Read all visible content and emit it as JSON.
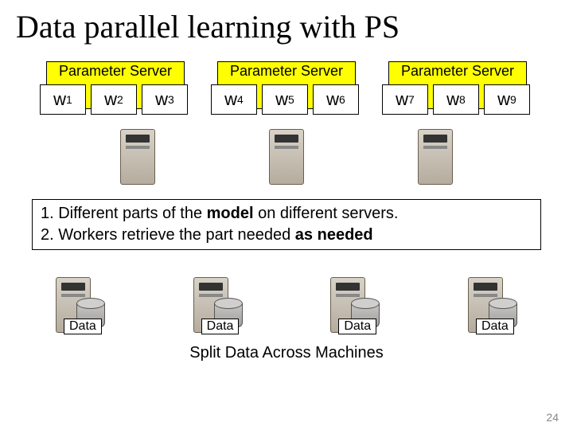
{
  "title": "Data parallel learning with PS",
  "ps": [
    {
      "label": "Parameter Server",
      "weights": [
        "w1",
        "w2",
        "w3"
      ]
    },
    {
      "label": "Parameter Server",
      "weights": [
        "w4",
        "w5",
        "w6"
      ]
    },
    {
      "label": "Parameter Server",
      "weights": [
        "w7",
        "w8",
        "w9"
      ]
    }
  ],
  "desc": {
    "line1a": "1. Different parts of the ",
    "line1b": "model",
    "line1c": " on different servers.",
    "line2a": "2. Workers retrieve the part needed ",
    "line2b": "as needed"
  },
  "workers": [
    {
      "label": "Data"
    },
    {
      "label": "Data"
    },
    {
      "label": "Data"
    },
    {
      "label": "Data"
    }
  ],
  "split_label": "Split Data Across Machines",
  "page_number": "24"
}
